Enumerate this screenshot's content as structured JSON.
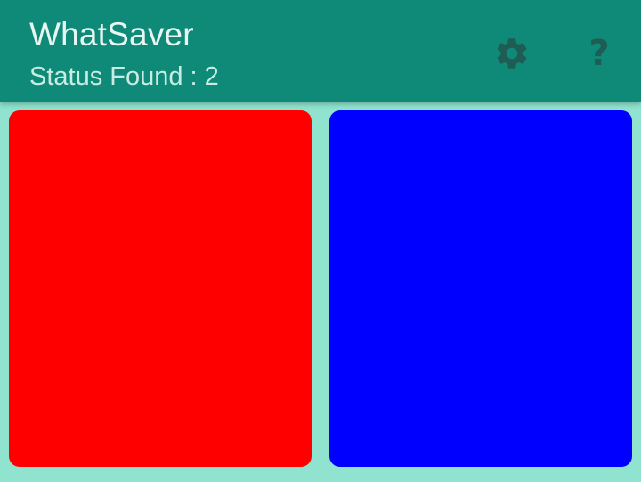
{
  "app_bar": {
    "title": "WhatSaver",
    "subtitle": "Status Found : 2",
    "actions": [
      {
        "icon": "gear-icon"
      },
      {
        "icon": "help-icon",
        "glyph": "?"
      }
    ]
  },
  "statuses": [
    {
      "color": "#ff0000"
    },
    {
      "color": "#0000ff"
    }
  ],
  "colors": {
    "app_bar": "#0f8a78",
    "background": "#8fe3cf",
    "icon": "#1f5d54"
  }
}
